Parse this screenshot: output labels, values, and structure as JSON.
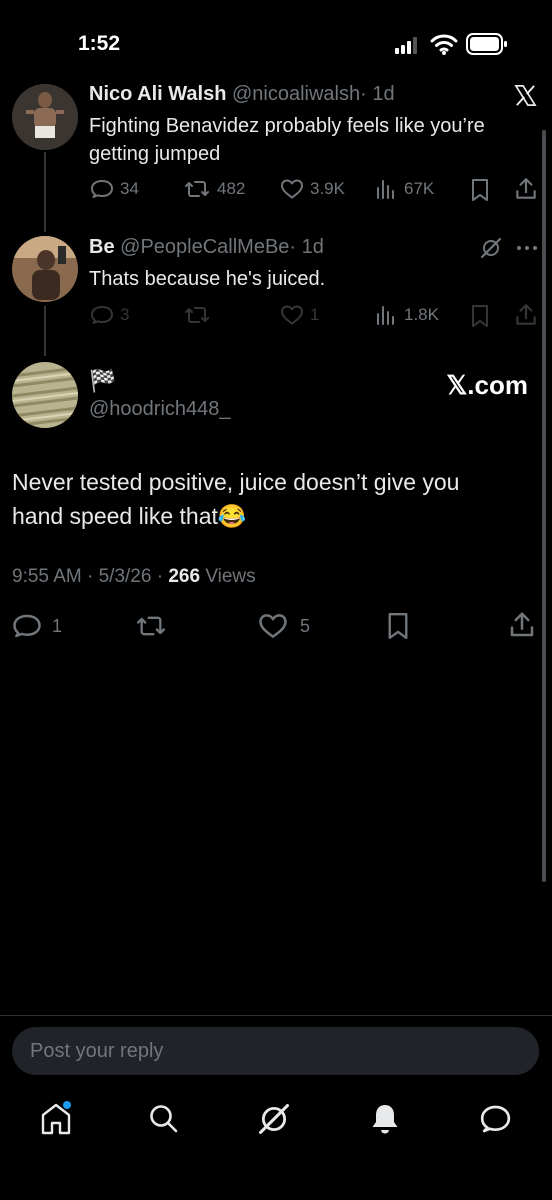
{
  "status_bar": {
    "time": "1:52"
  },
  "thread": [
    {
      "name": "Nico Ali Walsh",
      "handle": "@nicoaliwalsh",
      "age": "· 1d",
      "text_line1": "Fighting Benavidez probably feels like you’re",
      "text_line2": "getting jumped",
      "stats": {
        "replies": "34",
        "reposts": "482",
        "likes": "3.9K",
        "views": "67K"
      }
    },
    {
      "name": "Be",
      "handle": "@PeopleCallMeBe",
      "age": "· 1d",
      "text": "Thats because he's juiced.",
      "stats": {
        "replies": "3",
        "likes": "1",
        "views": "1.8K"
      }
    }
  ],
  "main_post": {
    "name_emoji": "🏁",
    "handle": "@hoodrich448_",
    "text_line1": "Never tested positive, juice doesn’t give you",
    "text_line2": "hand speed like that",
    "emoji": "😂",
    "time": "9:55 AM",
    "date": "· 5/3/26 ·",
    "views_count": "266",
    "views_label": "Views",
    "stats": {
      "replies": "1",
      "likes": "5"
    }
  },
  "watermark": "𝕏.com",
  "reply_input": {
    "placeholder": "Post your reply"
  },
  "icons": [
    "x-logo-icon",
    "reply-icon",
    "repost-icon",
    "like-icon",
    "views-icon",
    "bookmark-icon",
    "share-icon",
    "grok-icon",
    "more-icon",
    "home-icon",
    "search-icon",
    "grok-tab-icon",
    "notifications-icon",
    "messages-icon"
  ],
  "colors": {
    "background": "#000000",
    "text": "#e7e9ea",
    "muted": "#71767b",
    "notification_dot": "#1d9bf0"
  }
}
